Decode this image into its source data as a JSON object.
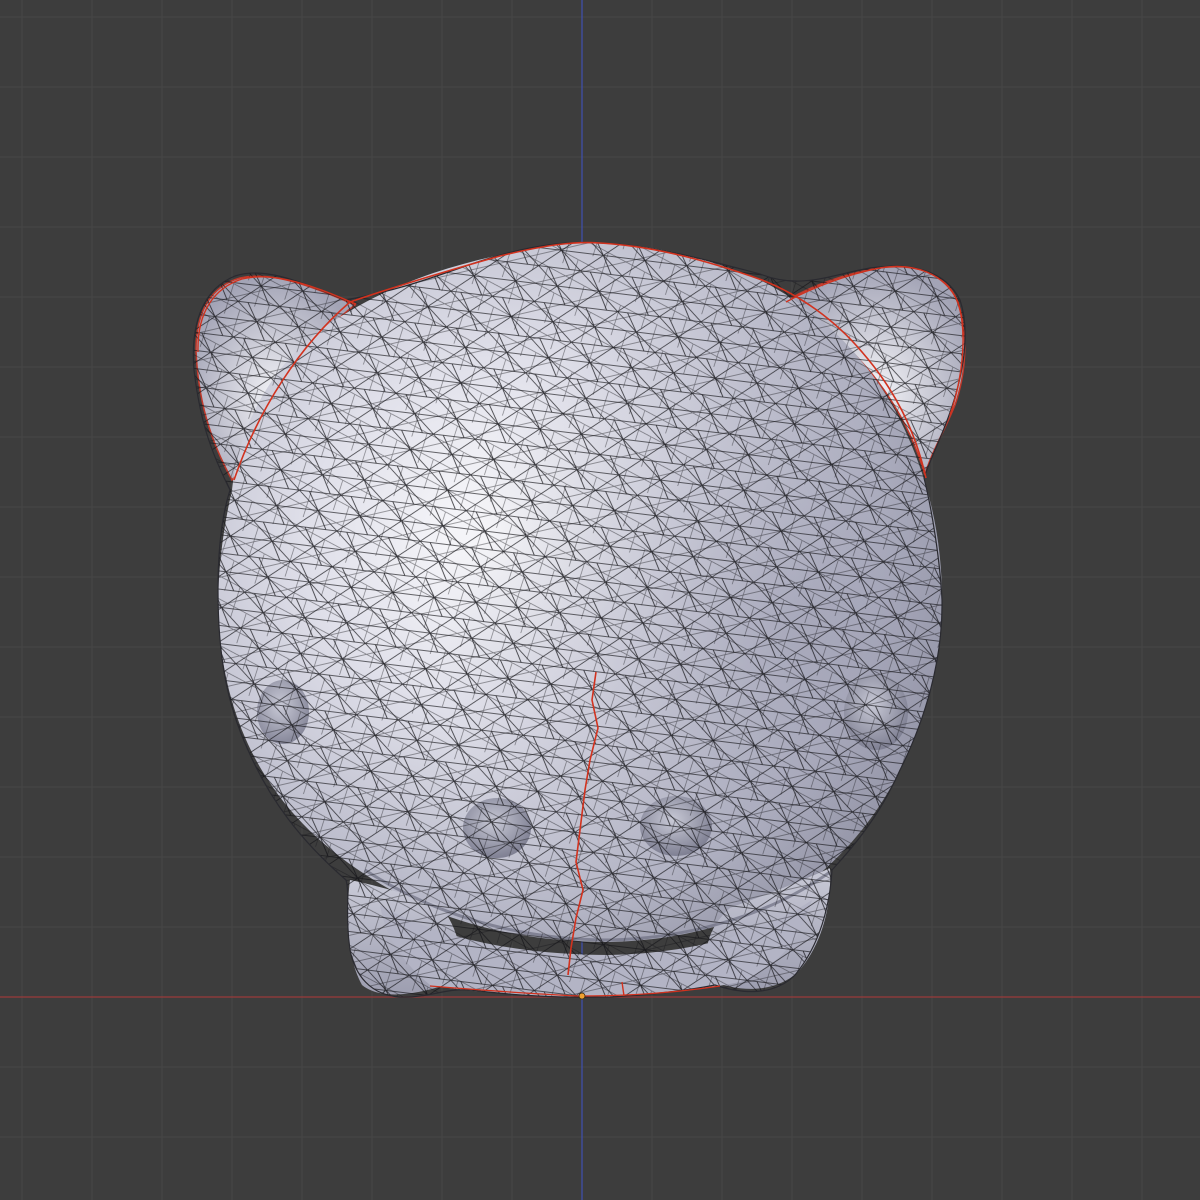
{
  "app": {
    "editor": "3d-viewport",
    "view": "front-orthographic",
    "mode": "edit-mode-wireframe-overlay"
  },
  "colors": {
    "background": "#3d3d3d",
    "grid_minor": "#464646",
    "grid_major": "#4c4c4c",
    "x_axis": "#9a3b3b",
    "z_axis": "#3f4fa8",
    "mesh_light": "#fbfbfd",
    "mesh_mid": "#b9bac9",
    "mesh_dark": "#7d7e90",
    "wire": "#141418",
    "seam": "#d2321e",
    "origin": "#f0a030"
  },
  "scene": {
    "object": "creature-head-mesh",
    "features": [
      "ear-left",
      "ear-right",
      "eye-left",
      "eye-right",
      "cheek-left",
      "cheek-right",
      "foot-left",
      "foot-right",
      "seam-edges",
      "origin-point"
    ]
  }
}
